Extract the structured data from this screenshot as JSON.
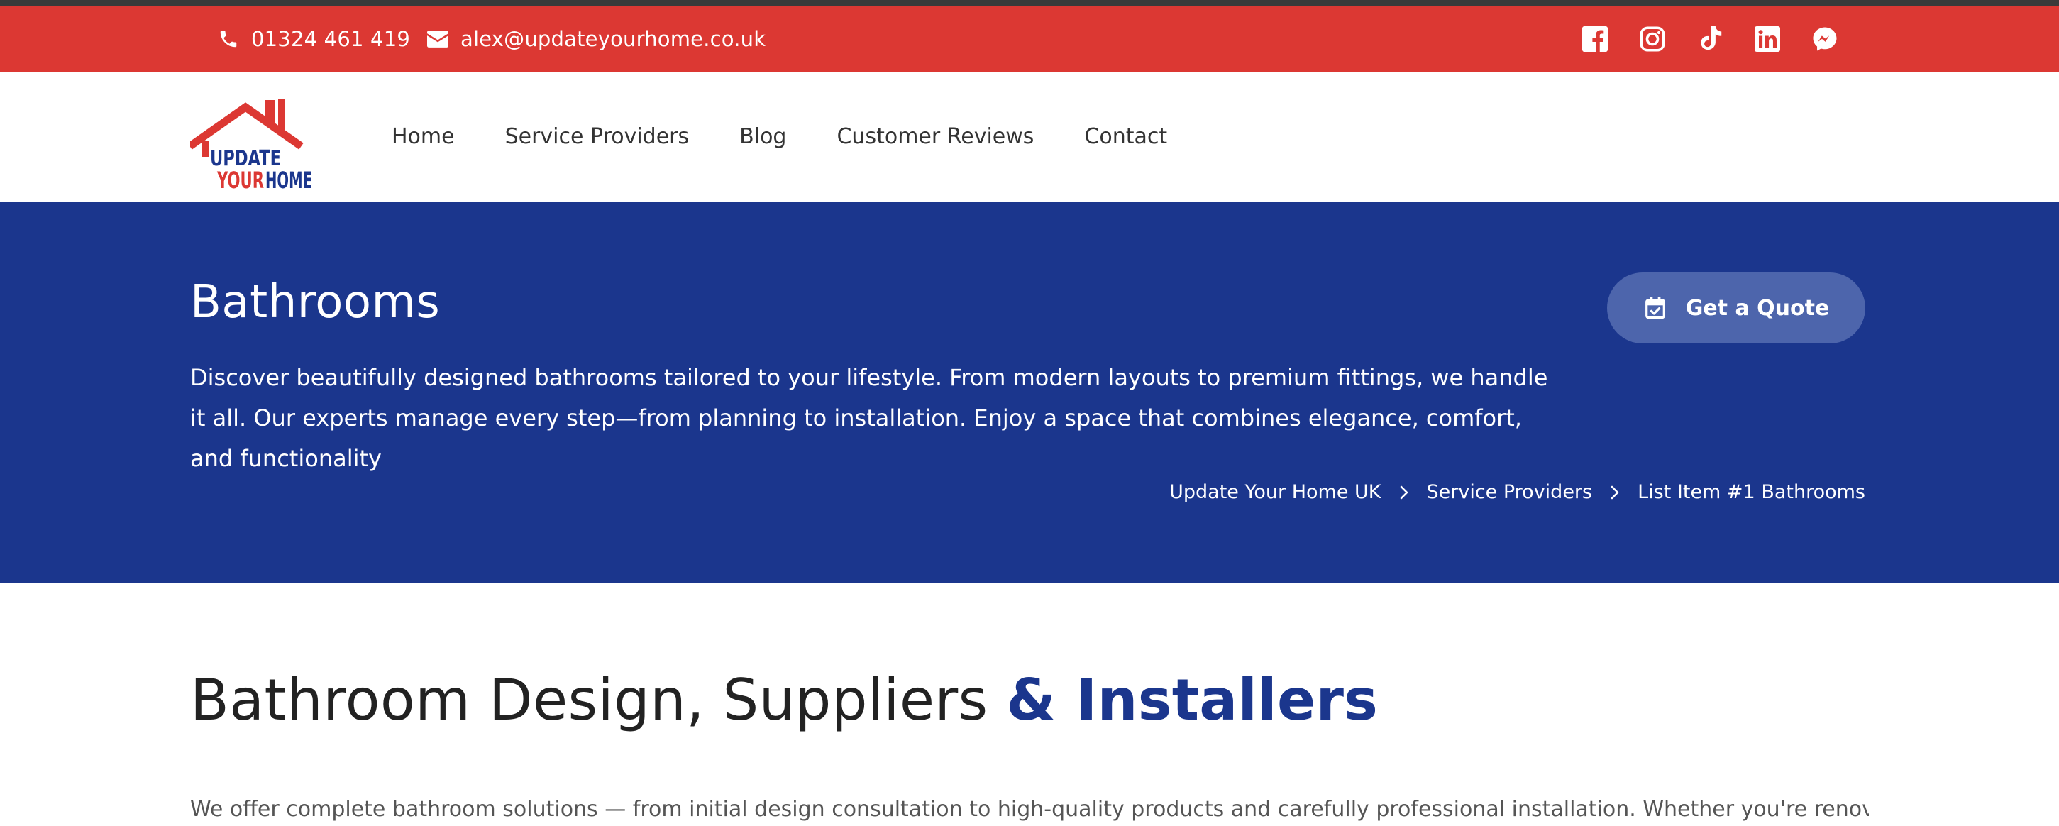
{
  "topbar": {
    "phone": "01324 461 419",
    "email": "alex@updateyourhome.co.uk",
    "bg_color": "#dc3833",
    "social": [
      {
        "name": "facebook-icon"
      },
      {
        "name": "instagram-icon"
      },
      {
        "name": "tiktok-icon"
      },
      {
        "name": "linkedin-icon"
      },
      {
        "name": "messenger-icon"
      }
    ]
  },
  "logo": {
    "line1": "UPDATE",
    "line2_a": "YOUR",
    "line2_b": "HOME"
  },
  "nav": {
    "items": [
      "Home",
      "Service Providers",
      "Blog",
      "Customer Reviews",
      "Contact"
    ]
  },
  "hero": {
    "bg_color": "#1b368d",
    "title": "Bathrooms",
    "description": "Discover beautifully designed bathrooms tailored to your lifestyle. From modern layouts to premium fittings, we handle it all. Our experts manage every step—from planning to installation. Enjoy a space that combines elegance, comfort, and functionality",
    "quote_button": "Get a Quote",
    "breadcrumbs": [
      "Update Your Home UK",
      "Service Providers",
      "List Item #1 Bathrooms"
    ]
  },
  "section": {
    "title_plain": "Bathroom Design, Suppliers ",
    "title_accent": "& Installers",
    "accent_color": "#1b368d",
    "intro_partial": "We offer complete bathroom solutions — from initial design consultation to high-quality products and carefully professional installation. Whether you're renovating or building"
  }
}
